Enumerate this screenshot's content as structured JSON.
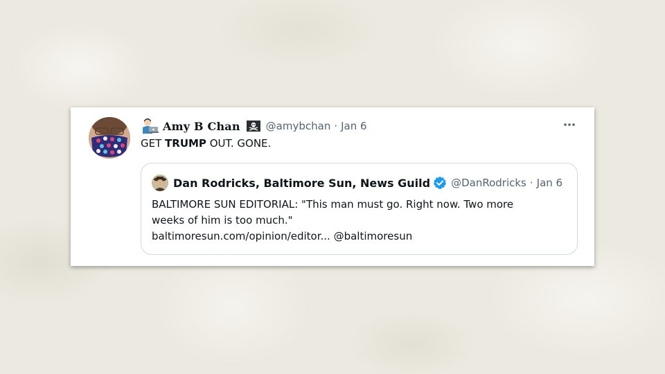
{
  "tweet": {
    "author": {
      "display_name": "Amy B Chan",
      "handle": "@amybchan",
      "lead_emoji": "woman-technologist-icon",
      "trailing_emoji": "pirate-flag-icon"
    },
    "separator": "·",
    "date": "Jan 6",
    "more_icon": "more-horizontal-icon",
    "text": {
      "prefix": "GET ",
      "bold": "TRUMP",
      "suffix": " OUT. GONE."
    }
  },
  "quoted_tweet": {
    "author": {
      "display_name": "Dan Rodricks, Baltimore Sun, News Guild",
      "handle": "@DanRodricks",
      "verified": true,
      "verified_icon": "verified-badge-icon"
    },
    "separator": "·",
    "date": "Jan 6",
    "text_lines": [
      "BALTIMORE SUN EDITORIAL: \"This man must go. Right now. Two more",
      "weeks of him is too much.\"",
      "baltimoresun.com/opinion/editor... @baltimoresun"
    ]
  },
  "colors": {
    "background": "#ece9e0",
    "card": "#ffffff",
    "text_primary": "#0f1419",
    "text_secondary": "#536471",
    "border": "#cfd9de",
    "verified_blue": "#1d9bf0"
  }
}
